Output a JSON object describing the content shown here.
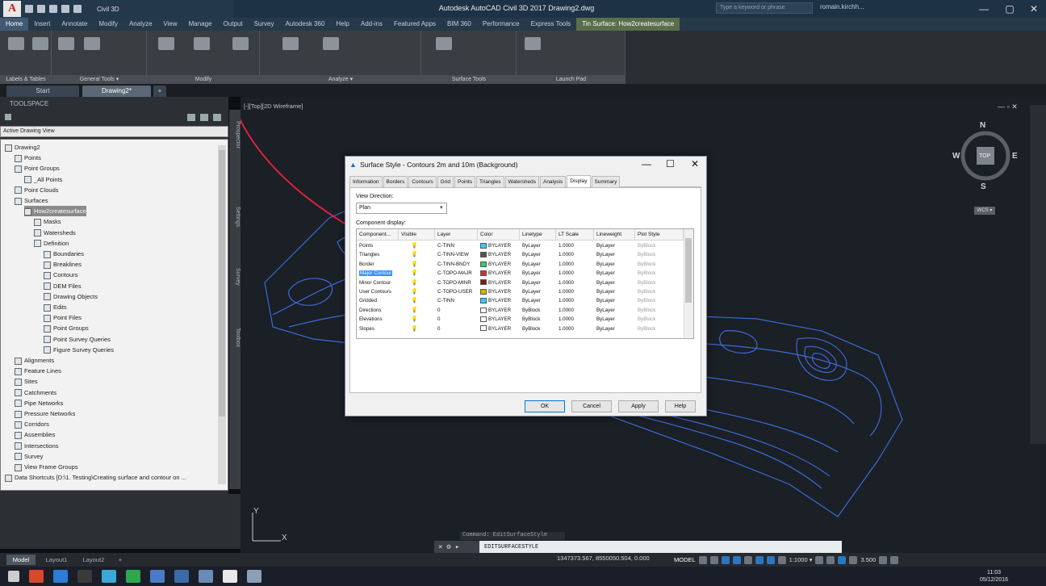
{
  "window": {
    "title": "Autodesk AutoCAD Civil 3D 2017   Drawing2.dwg",
    "workspace": "Civil 3D",
    "search_placeholder": "Type a keyword or phrase",
    "user": "romain.kirchh...",
    "minimize": "—",
    "maximize": "▢",
    "close": "✕"
  },
  "ribbon": {
    "tabs": [
      "Home",
      "Insert",
      "Annotate",
      "Modify",
      "Analyze",
      "View",
      "Manage",
      "Output",
      "Survey",
      "Autodesk 360",
      "Help",
      "Add-ins",
      "Featured Apps",
      "BIM 360",
      "Performance",
      "Express Tools",
      "Tin Surface: How2createsurface"
    ],
    "groups": [
      "Labels & Tables",
      "General Tools ▾",
      "Modify",
      "Analyze ▾",
      "Surface Tools",
      "Launch Pad"
    ]
  },
  "doc_tabs": [
    "Start",
    "Drawing2*",
    "+"
  ],
  "toolspace": {
    "title": "TOOLSPACE",
    "view": "Active Drawing View",
    "side_tabs": [
      "Prospector",
      "Settings",
      "Survey",
      "Toolbox"
    ],
    "tree": [
      {
        "label": "Drawing2",
        "level": 0
      },
      {
        "label": "Points",
        "level": 1
      },
      {
        "label": "Point Groups",
        "level": 1
      },
      {
        "label": "_All Points",
        "level": 2
      },
      {
        "label": "Point Clouds",
        "level": 1
      },
      {
        "label": "Surfaces",
        "level": 1
      },
      {
        "label": "How2createsurface",
        "level": 2,
        "selected": true
      },
      {
        "label": "Masks",
        "level": 3
      },
      {
        "label": "Watersheds",
        "level": 3
      },
      {
        "label": "Definition",
        "level": 3
      },
      {
        "label": "Boundaries",
        "level": 4
      },
      {
        "label": "Breaklines",
        "level": 4
      },
      {
        "label": "Contours",
        "level": 4
      },
      {
        "label": "DEM Files",
        "level": 4
      },
      {
        "label": "Drawing Objects",
        "level": 4
      },
      {
        "label": "Edits",
        "level": 4
      },
      {
        "label": "Point Files",
        "level": 4
      },
      {
        "label": "Point Groups",
        "level": 4
      },
      {
        "label": "Point Survey Queries",
        "level": 4
      },
      {
        "label": "Figure Survey Queries",
        "level": 4
      },
      {
        "label": "Alignments",
        "level": 1
      },
      {
        "label": "Feature Lines",
        "level": 1
      },
      {
        "label": "Sites",
        "level": 1
      },
      {
        "label": "Catchments",
        "level": 1
      },
      {
        "label": "Pipe Networks",
        "level": 1
      },
      {
        "label": "Pressure Networks",
        "level": 1
      },
      {
        "label": "Corridors",
        "level": 1
      },
      {
        "label": "Assemblies",
        "level": 1
      },
      {
        "label": "Intersections",
        "level": 1
      },
      {
        "label": "Survey",
        "level": 1
      },
      {
        "label": "View Frame Groups",
        "level": 1
      },
      {
        "label": "Data Shortcuts [D:\\1. Testing\\Creating surface and contour on ...",
        "level": 0
      }
    ]
  },
  "viewport": {
    "label": "[-][Top][2D Wireframe]",
    "controls": "— ▫ ✕",
    "compass": {
      "n": "N",
      "s": "S",
      "e": "E",
      "w": "W",
      "center": "TOP",
      "wcs": "WCS ▾"
    },
    "ucs": {
      "x": "X",
      "y": "Y"
    }
  },
  "command": {
    "history": "Command: EditSurfaceStyle",
    "current": "EDITSURFACESTYLE"
  },
  "layout_tabs": [
    "Model",
    "Layout1",
    "Layout2",
    "+"
  ],
  "status": {
    "coords": "1347373.567, 8550050.504, 0.000",
    "space": "MODEL",
    "scale": "1:1000 ▾",
    "elevation": "3.500"
  },
  "taskbar": {
    "time": "11:03",
    "date": "05/12/2016"
  },
  "dialog": {
    "title": "Surface Style - Contours 2m and 10m (Background)",
    "tabs": [
      "Information",
      "Borders",
      "Contours",
      "Grid",
      "Points",
      "Triangles",
      "Watersheds",
      "Analysis",
      "Display",
      "Summary"
    ],
    "active_tab": "Display",
    "view_direction_label": "View Direction:",
    "view_direction": "Plan",
    "component_display_label": "Component display:",
    "columns": [
      "Component...",
      "Visible",
      "Layer",
      "Color",
      "Linetype",
      "LT Scale",
      "Lineweight",
      "Plot Style"
    ],
    "rows": [
      {
        "component": "Points",
        "visible": true,
        "layer": "C-TINN",
        "color_name": "BYLAYER",
        "swatch": "#33ccff",
        "linetype": "ByLayer",
        "ltscale": "1.0000",
        "lineweight": "ByLayer",
        "plotstyle": "ByBlock"
      },
      {
        "component": "Triangles",
        "visible": false,
        "layer": "C-TINN-VIEW",
        "color_name": "BYLAYER",
        "swatch": "#555555",
        "linetype": "ByLayer",
        "ltscale": "1.0000",
        "lineweight": "ByLayer",
        "plotstyle": "ByBlock"
      },
      {
        "component": "Border",
        "visible": true,
        "layer": "C-TINN-BNDY",
        "color_name": "BYLAYER",
        "swatch": "#33cc66",
        "linetype": "ByLayer",
        "ltscale": "1.0000",
        "lineweight": "ByLayer",
        "plotstyle": "ByBlock"
      },
      {
        "component": "Major Contour",
        "visible": true,
        "layer": "C-TOPO-MAJR",
        "color_name": "BYLAYER",
        "swatch": "#cc3333",
        "linetype": "ByLayer",
        "ltscale": "1.0000",
        "lineweight": "ByLayer",
        "plotstyle": "ByBlock",
        "selected": true
      },
      {
        "component": "Minor Contour",
        "visible": true,
        "layer": "C-TOPO-MINR",
        "color_name": "BYLAYER",
        "swatch": "#7a1f1f",
        "linetype": "ByLayer",
        "ltscale": "1.0000",
        "lineweight": "ByLayer",
        "plotstyle": "ByBlock"
      },
      {
        "component": "User Contours",
        "visible": false,
        "layer": "C-TOPO-USER",
        "color_name": "BYLAYER",
        "swatch": "#d4b400",
        "linetype": "ByLayer",
        "ltscale": "1.0000",
        "lineweight": "ByLayer",
        "plotstyle": "ByBlock"
      },
      {
        "component": "Gridded",
        "visible": false,
        "layer": "C-TINN",
        "color_name": "BYLAYER",
        "swatch": "#33ccff",
        "linetype": "ByLayer",
        "ltscale": "1.0000",
        "lineweight": "ByLayer",
        "plotstyle": "ByBlock"
      },
      {
        "component": "Directions",
        "visible": false,
        "layer": "0",
        "color_name": "BYLAYER",
        "swatch": "#ffffff",
        "linetype": "ByBlock",
        "ltscale": "1.0000",
        "lineweight": "ByLayer",
        "plotstyle": "ByBlock"
      },
      {
        "component": "Elevations",
        "visible": false,
        "layer": "0",
        "color_name": "BYLAYER",
        "swatch": "#ffffff",
        "linetype": "ByBlock",
        "ltscale": "1.0000",
        "lineweight": "ByLayer",
        "plotstyle": "ByBlock"
      },
      {
        "component": "Slopes",
        "visible": false,
        "layer": "0",
        "color_name": "BYLAYER",
        "swatch": "#ffffff",
        "linetype": "ByBlock",
        "ltscale": "1.0000",
        "lineweight": "ByLayer",
        "plotstyle": "ByBlock"
      }
    ],
    "buttons": {
      "ok": "OK",
      "cancel": "Cancel",
      "apply": "Apply",
      "help": "Help"
    },
    "minimize": "—",
    "maximize": "☐",
    "close": "✕"
  },
  "colors": {
    "contour": "#3a6bd6",
    "annotation_arrow": "#e0203c",
    "titlebar": "#1e3245"
  }
}
